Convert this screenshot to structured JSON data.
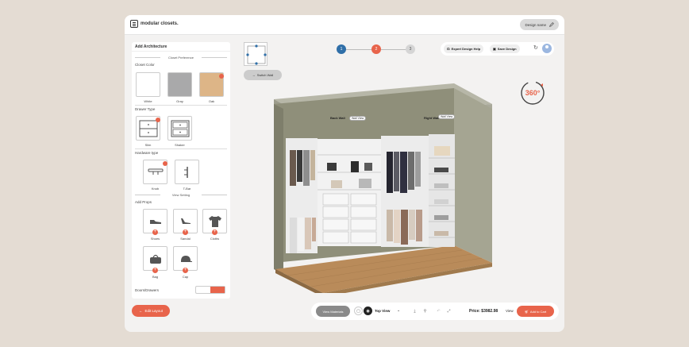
{
  "topbar": {
    "logo_text": "modular closets.",
    "design_name_label": "Design name"
  },
  "sidebar": {
    "title": "Add Architecture",
    "closet_preference_label": "Closet Preference",
    "closet_color_label": "Closet Color",
    "colors": [
      {
        "label": "White",
        "hex": "#ffffff"
      },
      {
        "label": "Gray",
        "hex": "#a9a9aa"
      },
      {
        "label": "Oak",
        "hex": "#ddb587"
      }
    ],
    "drawer_type_label": "Drawer Type",
    "drawer_types": [
      {
        "label": "Slim"
      },
      {
        "label": "Shaker"
      }
    ],
    "hardware_type_label": "Hardware type",
    "hardware_types": [
      {
        "label": "Knob"
      },
      {
        "label": "T-Bar"
      }
    ],
    "view_setting_label": "View Setting",
    "add_props_label": "Add Props",
    "props": [
      {
        "label": "Shoes",
        "icon": "shoe-icon"
      },
      {
        "label": "Sandal",
        "icon": "sandal-icon"
      },
      {
        "label": "Cloths",
        "icon": "shirt-icon"
      },
      {
        "label": "Bag",
        "icon": "bag-icon"
      },
      {
        "label": "Cap",
        "icon": "cap-icon"
      }
    ],
    "doors_drawers_label": "Doors/Drawers",
    "edit_layout_label": "Edit Layout"
  },
  "canvas": {
    "switch_wall_label": "Switch Wall",
    "steps": [
      "1",
      "2",
      "3"
    ],
    "back_wall_label": "Back Wall",
    "right_wall_label": "Right Wall",
    "wall_view_label": "Wall View",
    "rotate_label": "360°"
  },
  "actions": {
    "expert_help_label": "Expert Design Help",
    "save_design_label": "Save Design"
  },
  "bottombar": {
    "view_materials_label": "View Materials",
    "view_mode_label": "Top View",
    "price_text": "Price: $3982.98",
    "view_label": "View",
    "add_to_cart_label": "Add to Cart"
  },
  "colors": {
    "accent": "#e8644b",
    "step_active": "#2f6fa8"
  }
}
